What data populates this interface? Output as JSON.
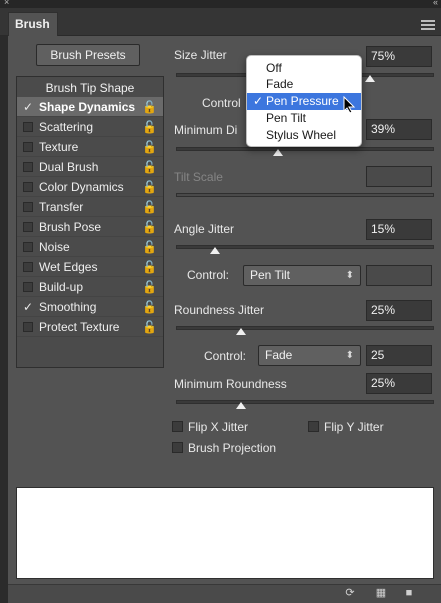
{
  "panel": {
    "tab": "Brush",
    "close": "×",
    "collapse": "«"
  },
  "left": {
    "preset_button": "Brush Presets",
    "tip_shape": "Brush Tip Shape",
    "items": [
      {
        "label": "Shape Dynamics",
        "checked": true,
        "selected": true
      },
      {
        "label": "Scattering",
        "checked": false
      },
      {
        "label": "Texture",
        "checked": false
      },
      {
        "label": "Dual Brush",
        "checked": false
      },
      {
        "label": "Color Dynamics",
        "checked": false
      },
      {
        "label": "Transfer",
        "checked": false
      },
      {
        "label": "Brush Pose",
        "checked": false
      },
      {
        "label": "Noise",
        "checked": false
      },
      {
        "label": "Wet Edges",
        "checked": false
      },
      {
        "label": "Build-up",
        "checked": false
      },
      {
        "label": "Smoothing",
        "checked": true
      },
      {
        "label": "Protect Texture",
        "checked": false
      }
    ]
  },
  "right": {
    "size_jitter": {
      "label": "Size Jitter",
      "value": "75%",
      "level": 0.75
    },
    "control1": {
      "label": "Control"
    },
    "min_diameter": {
      "label": "Minimum Di",
      "value": "39%",
      "level": 0.39
    },
    "tilt_scale": {
      "label": "Tilt Scale"
    },
    "angle_jitter": {
      "label": "Angle Jitter",
      "value": "15%",
      "level": 0.15
    },
    "control2": {
      "label": "Control:",
      "value": "Pen Tilt",
      "arrow": "⬍"
    },
    "roundness_jitter": {
      "label": "Roundness Jitter",
      "value": "25%",
      "level": 0.25
    },
    "control3": {
      "label": "Control:",
      "value": "Fade",
      "arrow": "⬍",
      "amount": "25"
    },
    "min_roundness": {
      "label": "Minimum Roundness",
      "value": "25%",
      "level": 0.25
    },
    "flip_x": "Flip X Jitter",
    "flip_y": "Flip Y Jitter",
    "projection": "Brush Projection"
  },
  "popup": {
    "items": [
      {
        "label": "Off"
      },
      {
        "label": "Fade"
      },
      {
        "label": "Pen Pressure",
        "checked": true,
        "check": "✓"
      },
      {
        "label": "Pen Tilt"
      },
      {
        "label": "Stylus Wheel"
      }
    ]
  },
  "lock_glyph": "🔓",
  "colors": {
    "panel": "#535353",
    "highlight": "#3c76de",
    "field": "#3a3a3a"
  },
  "icons": [
    "lock-icon",
    "checkmark-icon",
    "create-new-brush-icon",
    "toggle-preview-icon",
    "new-preset-icon",
    "panel-menu-icon"
  ]
}
